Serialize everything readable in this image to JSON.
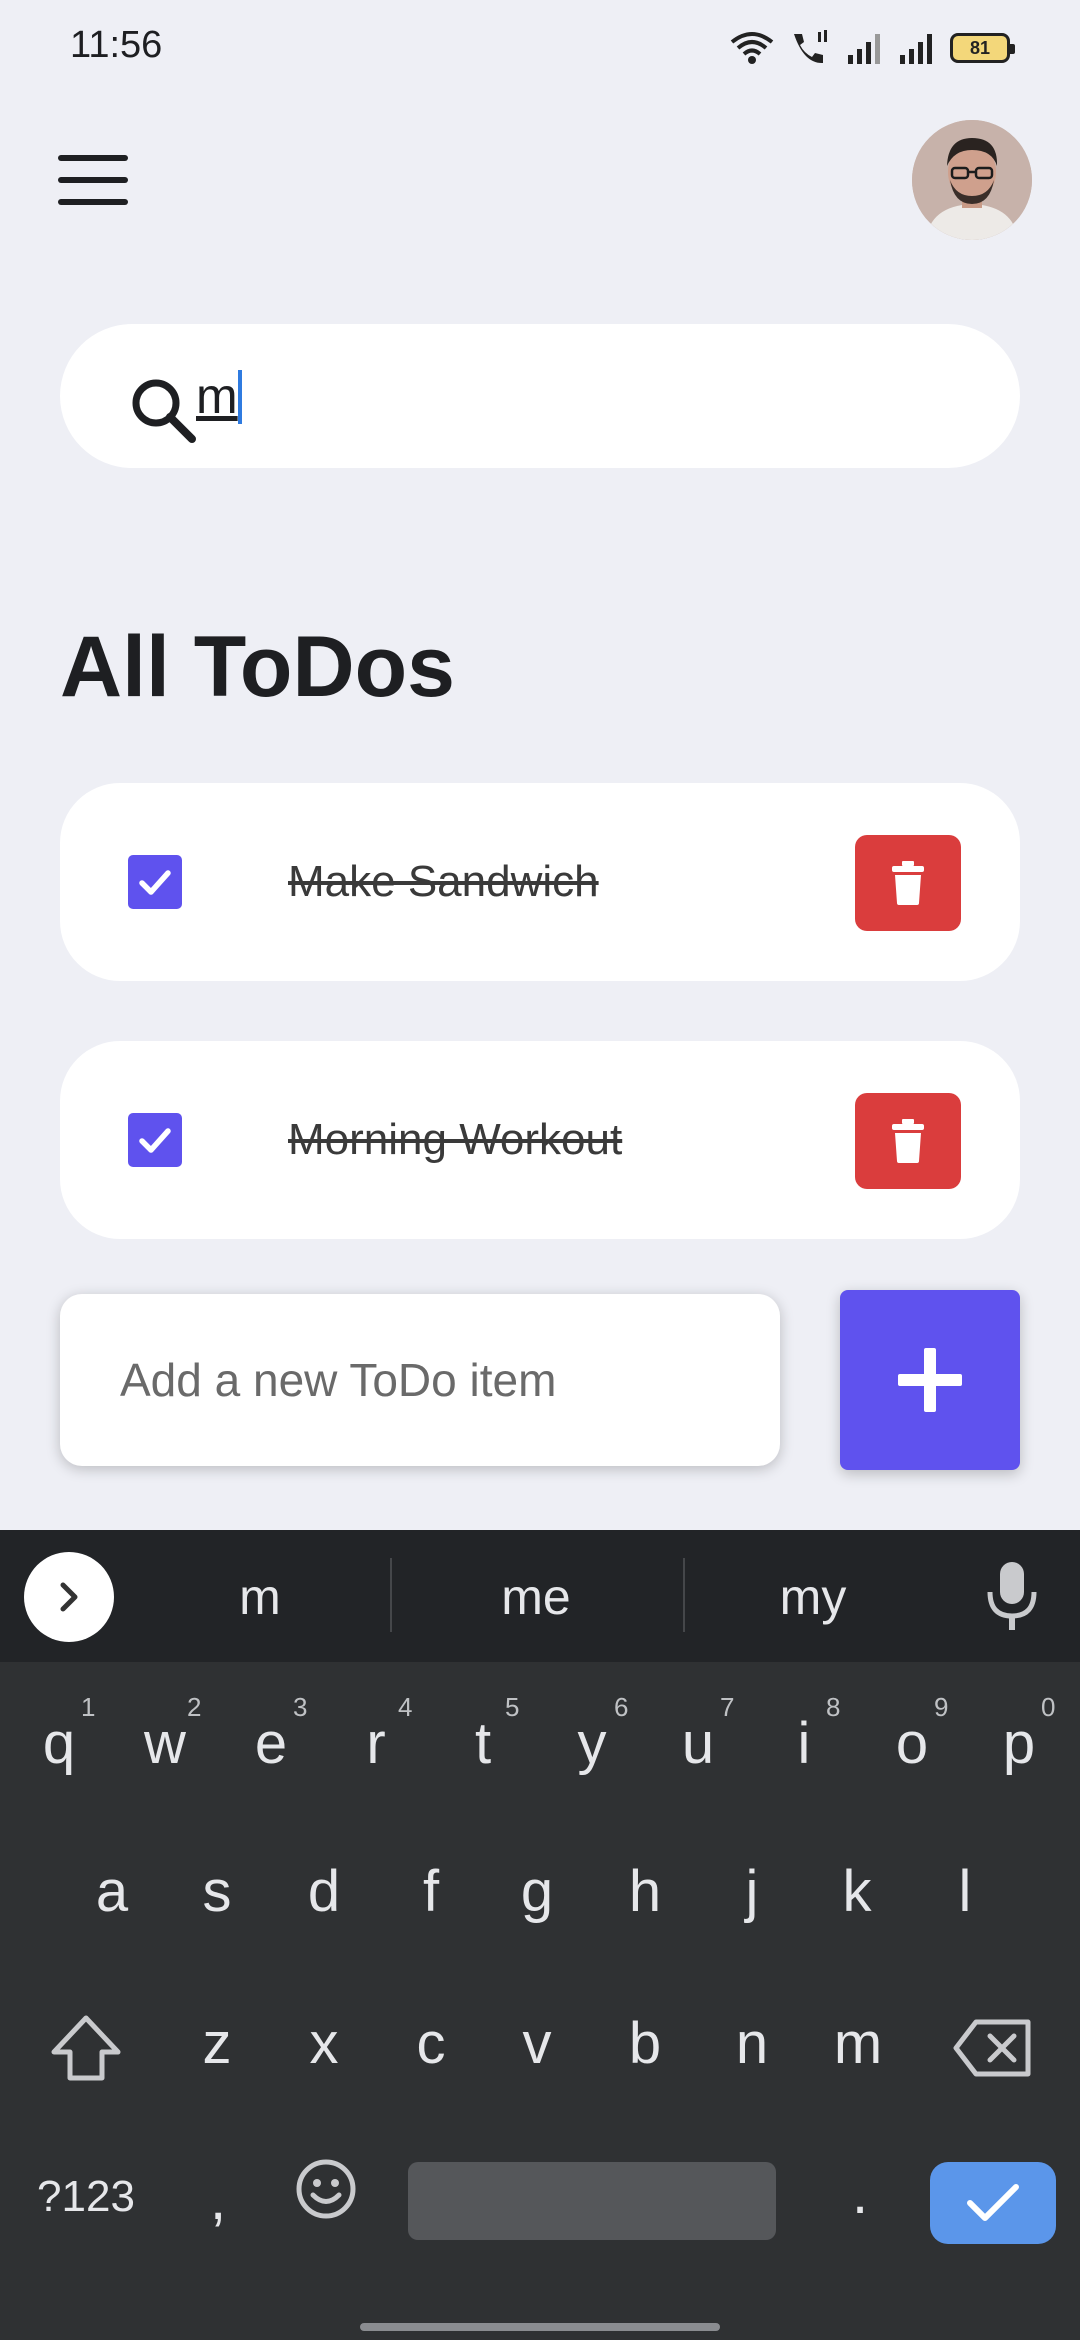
{
  "status_bar": {
    "time": "11:56",
    "battery": "81"
  },
  "header": {
    "menu_icon": "hamburger-menu-icon",
    "avatar_icon": "user-avatar"
  },
  "search": {
    "value": "m",
    "placeholder": ""
  },
  "main": {
    "title": "All ToDos",
    "todos": [
      {
        "text": "Make Sandwich",
        "done": true
      },
      {
        "text": "Morning Workout",
        "done": true
      }
    ]
  },
  "add_todo": {
    "placeholder": "Add a new ToDo item",
    "button_icon": "plus-icon"
  },
  "colors": {
    "accent": "#5F52EE",
    "delete": "#DA3D3D",
    "background": "#EEEFF5"
  },
  "keyboard": {
    "suggestions": [
      "m",
      "me",
      "my"
    ],
    "row1": [
      "q",
      "w",
      "e",
      "r",
      "t",
      "y",
      "u",
      "i",
      "o",
      "p"
    ],
    "row1_hints": [
      "1",
      "2",
      "3",
      "4",
      "5",
      "6",
      "7",
      "8",
      "9",
      "0"
    ],
    "row2": [
      "a",
      "s",
      "d",
      "f",
      "g",
      "h",
      "j",
      "k",
      "l"
    ],
    "row3": [
      "z",
      "x",
      "c",
      "v",
      "b",
      "n",
      "m"
    ],
    "symbols_key": "?123",
    "comma_key": ",",
    "period_key": "."
  }
}
